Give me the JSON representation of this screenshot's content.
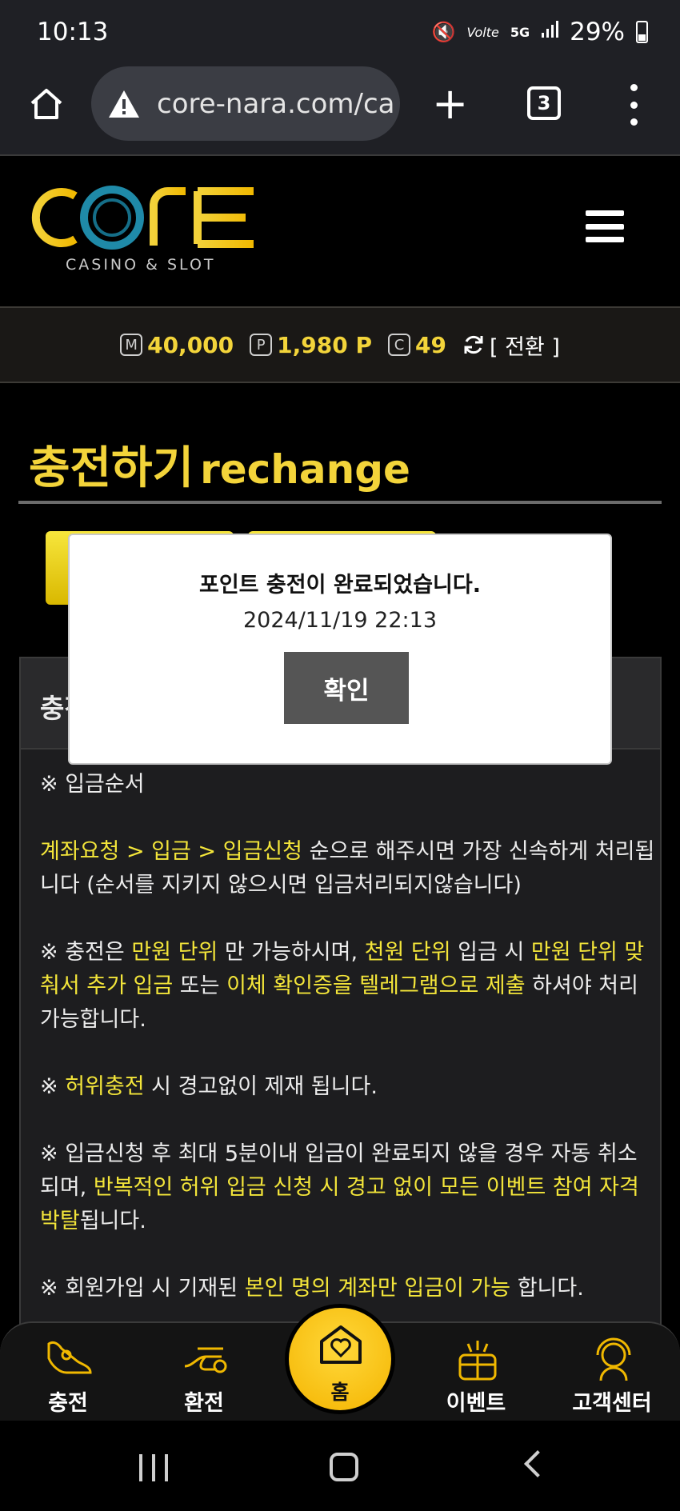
{
  "status": {
    "time": "10:13",
    "network": "5G",
    "volte": "Volte",
    "battery": "29%"
  },
  "browser": {
    "url": "core-nara.com/ca",
    "tab_count": "3"
  },
  "site": {
    "logo_main": "CORE",
    "logo_sub": "CASINO & SLOT"
  },
  "balance": {
    "m_badge": "M",
    "m_value": "40,000",
    "p_badge": "P",
    "p_value": "1,980 P",
    "c_badge": "C",
    "c_value": "49",
    "switch_label": "[ 전환 ]"
  },
  "page": {
    "title_ko": "충전하기",
    "title_en": "rechange",
    "panel_head": "충전"
  },
  "notice": {
    "n1": "※ 입금순서",
    "n2_hl": "계좌요청 > 입금 > 입금신청",
    "n2_text": " 순으로 해주시면 가장 신속하게 처리됩니다 (순서를 지키지 않으시면 입금처리되지않습니다)",
    "n3_a": "※ 충전은 ",
    "n3_hl1": "만원 단위",
    "n3_b": " 만 가능하시며, ",
    "n3_hl2": "천원 단위",
    "n3_c": " 입금 시 ",
    "n3_hl3": "만원 단위 맞춰서 추가 입금",
    "n3_d": " 또는 ",
    "n3_hl4": "이체 확인증을 텔레그램으로 제출",
    "n3_e": " 하셔야 처리 가능합니다.",
    "n4_a": "※ ",
    "n4_hl": "허위충전",
    "n4_b": " 시 경고없이 제재 됩니다.",
    "n5_a": "※ 입금신청 후 최대 5분이내 입금이 완료되지 않을 경우 자동 취소되며, ",
    "n5_hl": "반복적인 허위 입금 신청 시 경고 없이 모든 이벤트 참여 자격 박탈",
    "n5_b": "됩니다.",
    "n6_a": "※ 회원가입 시 기재된 ",
    "n6_hl": "본인 명의 계좌만 입금이 가능",
    "n6_b": " 합니다."
  },
  "modal": {
    "message": "포인트 충전이 완료되었습니다.",
    "datetime": "2024/11/19 22:13",
    "ok_label": "확인"
  },
  "bottom_nav": {
    "charge": "충전",
    "exchange": "환전",
    "home": "홈",
    "event": "이벤트",
    "support": "고객센터"
  },
  "colors": {
    "accent": "#f3d43a",
    "highlight": "#f3e53a"
  }
}
